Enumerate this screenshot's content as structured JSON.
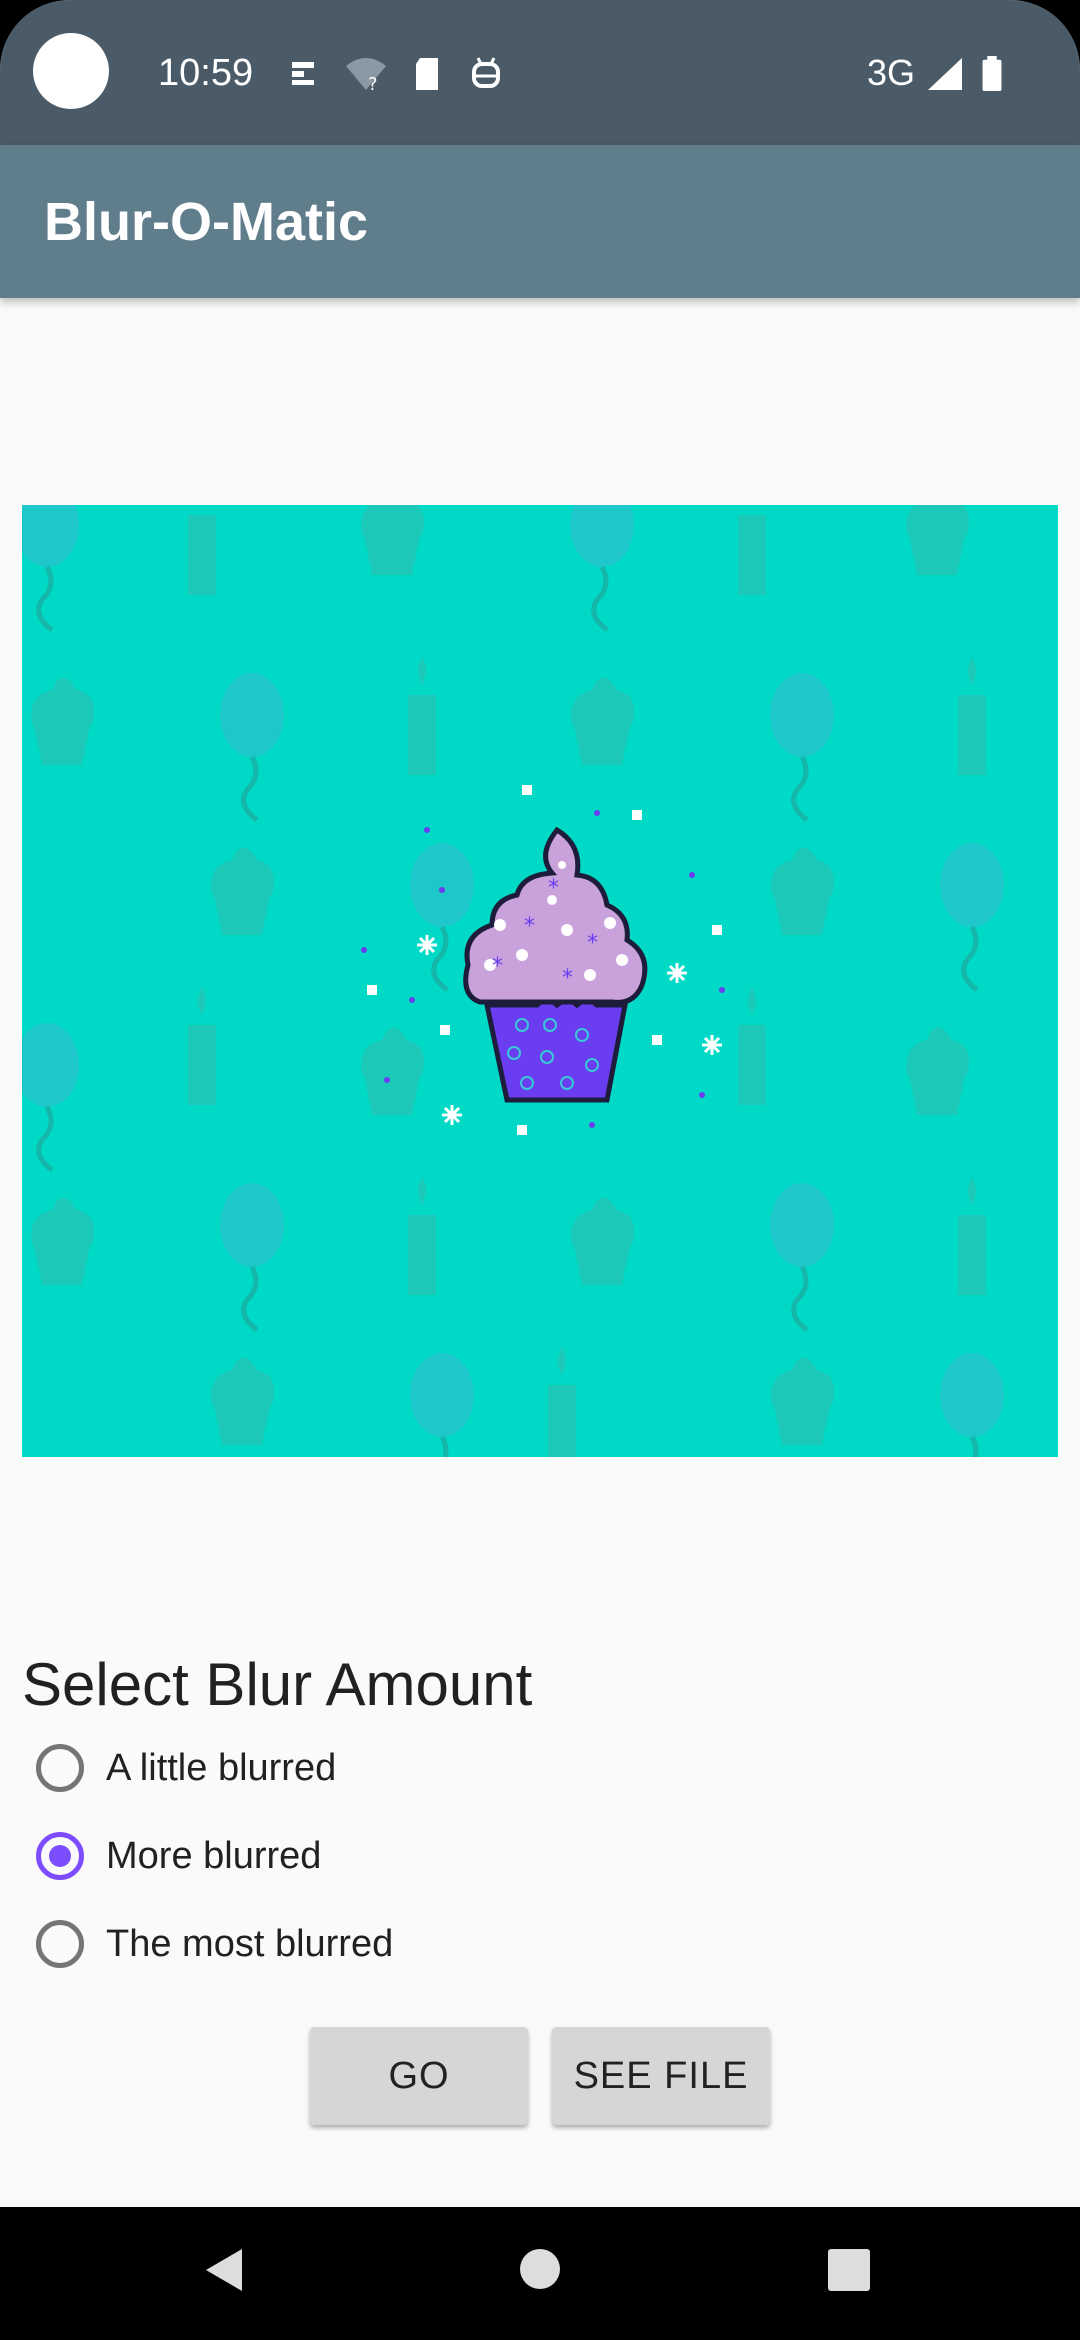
{
  "status_bar": {
    "time": "10:59",
    "network": "3G",
    "icons": [
      "notification-icon",
      "wifi-unknown-icon",
      "sd-card-icon",
      "android-debug-icon",
      "signal-icon",
      "battery-icon"
    ]
  },
  "app_bar": {
    "title": "Blur-O-Matic"
  },
  "hero": {
    "icon": "cupcake-image",
    "background_color": "#00d9c6"
  },
  "blur_section": {
    "title": "Select Blur Amount",
    "options": [
      {
        "label": "A little blurred",
        "checked": false
      },
      {
        "label": "More blurred",
        "checked": true
      },
      {
        "label": "The most blurred",
        "checked": false
      }
    ]
  },
  "buttons": {
    "go": "GO",
    "see_file": "SEE FILE"
  },
  "nav_bar": {
    "icons": [
      "back-icon",
      "home-icon",
      "recents-icon"
    ]
  },
  "colors": {
    "accent": "#7c4dff",
    "app_bar": "#607d8b",
    "status_bar": "#4a5a66"
  }
}
